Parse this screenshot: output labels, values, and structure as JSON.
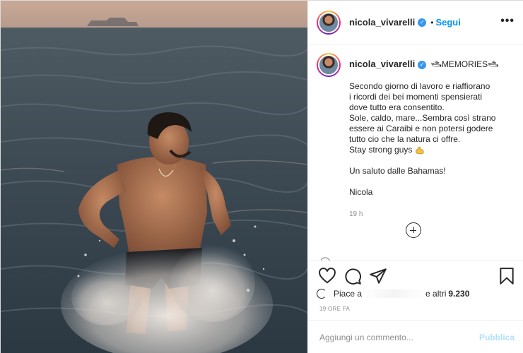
{
  "post": {
    "username": "nicola_vivarelli",
    "dot": "•",
    "follow_label": "Segui",
    "more_label": "•••"
  },
  "caption": {
    "title_emoji": "🛥MEMORIES🛥",
    "lines": [
      "Secondo giorno di lavoro e riaffiorano",
      "i ricordi dei bei momenti spensierati",
      "dove tutto era consentito.",
      "Sole, caldo, mare...Sembra così strano",
      "essere ai Caraibi e non potersi godere",
      "tutto cio che la natura ci offre.",
      "Stay strong guys"
    ],
    "greeting": "Un saluto dalle Bahamas!",
    "signature": "Nicola",
    "time": "19 h"
  },
  "likes": {
    "prefix": "Piace a",
    "suffix": "e altri",
    "count": "9.230"
  },
  "time_ago": "19 ORE FA",
  "comment": {
    "placeholder": "Aggiungi un commento...",
    "publish_label": "Pubblica"
  },
  "colors": {
    "link": "#0095f6",
    "publish_disabled": "#b2dffc",
    "verified": "#3897f0"
  }
}
